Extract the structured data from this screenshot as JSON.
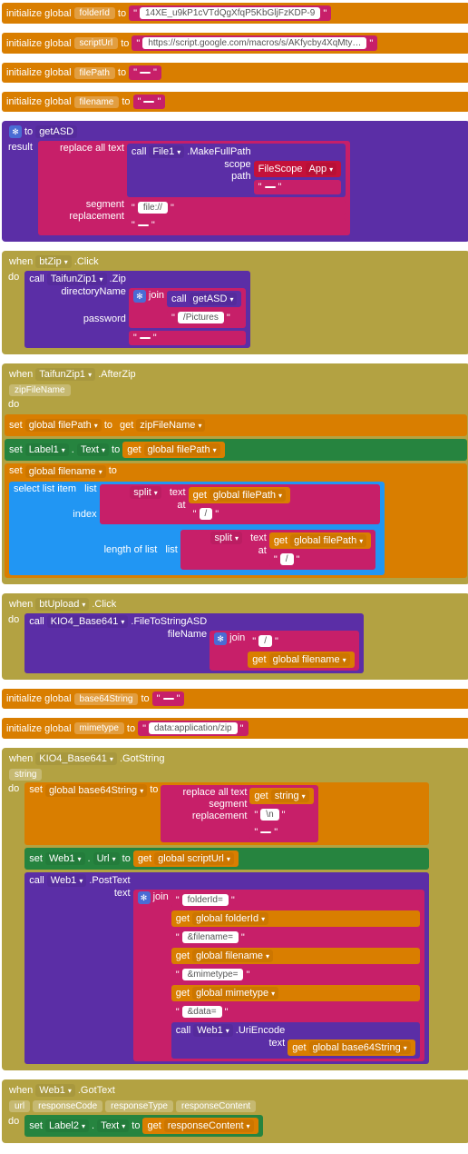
{
  "kw": {
    "initGlobal": "initialize global",
    "to": "to",
    "when": "when",
    "do": "do",
    "call": "call",
    "set": "set",
    "get": "get",
    "result": "result",
    "scope": "scope",
    "path": "path",
    "segment": "segment",
    "replacement": "replacement",
    "replaceAllText": "replace all text",
    "directoryName": "directoryName",
    "password": "password",
    "join": "join",
    "selectListItem": "select list item",
    "list": "list",
    "index": "index",
    "text": "text",
    "at": "at",
    "lengthOfList": "length of list",
    "split": "split",
    "fileName": "fileName",
    "url": "url",
    "responseCode": "responseCode",
    "responseType": "responseType",
    "responseContent": "responseContent",
    "string": "string",
    "zipFileName": "zipFileName"
  },
  "vars": {
    "folderId": "folderId",
    "scriptUrl": "scriptUrl",
    "filePath": "filePath",
    "filename": "filename",
    "base64String": "base64String",
    "mimetype": "mimetype"
  },
  "vals": {
    "folderId": "14XE_u9kP1cVTdQgXfqP5KbGljFzKDP-9",
    "scriptUrl": "https://script.google.com/macros/s/AKfycby4XqMty…",
    "fileProto": "file://",
    "slash": "/",
    "pictures": "/Pictures",
    "mimetype": "data:application/zip",
    "newline": "\\n",
    "empty": " ",
    "folderIdEq": "folderId=",
    "andFilename": "&filename=",
    "andMimetype": "&mimetype=",
    "andData": "&data="
  },
  "comp": {
    "getASD": "getASD",
    "File1": "File1",
    "MakeFullPath": ".MakeFullPath",
    "FileScope": "FileScope",
    "App": "App",
    "btZip": "btZip",
    "Click": ".Click",
    "TaifunZip1": "TaifunZip1",
    "Zip": ".Zip",
    "AfterZip": ".AfterZip",
    "Label1": "Label1",
    "Label2": "Label2",
    "Text": "Text",
    "btUpload": "btUpload",
    "KIO4_Base641": "KIO4_Base641",
    "FileToStringASD": ".FileToStringASD",
    "GotString": ".GotString",
    "Web1": "Web1",
    "Url": "Url",
    "PostText": ".PostText",
    "UriEncode": ".UriEncode",
    "GotText": ".GotText"
  },
  "getters": {
    "globalFilePath": "global filePath",
    "globalFilename": "global filename",
    "globalFolderId": "global folderId",
    "globalScriptUrl": "global scriptUrl",
    "globalMimetype": "global mimetype",
    "globalBase64String": "global base64String",
    "zipFileName": "zipFileName",
    "string": "string",
    "responseContent": "responseContent"
  }
}
